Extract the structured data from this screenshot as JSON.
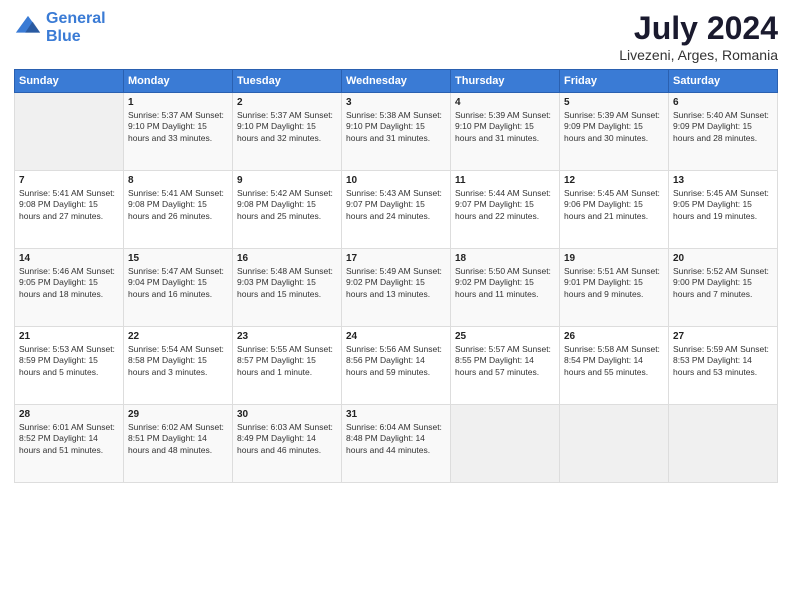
{
  "header": {
    "logo_line1": "General",
    "logo_line2": "Blue",
    "title": "July 2024",
    "subtitle": "Livezeni, Arges, Romania"
  },
  "days_of_week": [
    "Sunday",
    "Monday",
    "Tuesday",
    "Wednesday",
    "Thursday",
    "Friday",
    "Saturday"
  ],
  "weeks": [
    [
      {
        "day": "",
        "info": ""
      },
      {
        "day": "1",
        "info": "Sunrise: 5:37 AM\nSunset: 9:10 PM\nDaylight: 15 hours\nand 33 minutes."
      },
      {
        "day": "2",
        "info": "Sunrise: 5:37 AM\nSunset: 9:10 PM\nDaylight: 15 hours\nand 32 minutes."
      },
      {
        "day": "3",
        "info": "Sunrise: 5:38 AM\nSunset: 9:10 PM\nDaylight: 15 hours\nand 31 minutes."
      },
      {
        "day": "4",
        "info": "Sunrise: 5:39 AM\nSunset: 9:10 PM\nDaylight: 15 hours\nand 31 minutes."
      },
      {
        "day": "5",
        "info": "Sunrise: 5:39 AM\nSunset: 9:09 PM\nDaylight: 15 hours\nand 30 minutes."
      },
      {
        "day": "6",
        "info": "Sunrise: 5:40 AM\nSunset: 9:09 PM\nDaylight: 15 hours\nand 28 minutes."
      }
    ],
    [
      {
        "day": "7",
        "info": "Sunrise: 5:41 AM\nSunset: 9:08 PM\nDaylight: 15 hours\nand 27 minutes."
      },
      {
        "day": "8",
        "info": "Sunrise: 5:41 AM\nSunset: 9:08 PM\nDaylight: 15 hours\nand 26 minutes."
      },
      {
        "day": "9",
        "info": "Sunrise: 5:42 AM\nSunset: 9:08 PM\nDaylight: 15 hours\nand 25 minutes."
      },
      {
        "day": "10",
        "info": "Sunrise: 5:43 AM\nSunset: 9:07 PM\nDaylight: 15 hours\nand 24 minutes."
      },
      {
        "day": "11",
        "info": "Sunrise: 5:44 AM\nSunset: 9:07 PM\nDaylight: 15 hours\nand 22 minutes."
      },
      {
        "day": "12",
        "info": "Sunrise: 5:45 AM\nSunset: 9:06 PM\nDaylight: 15 hours\nand 21 minutes."
      },
      {
        "day": "13",
        "info": "Sunrise: 5:45 AM\nSunset: 9:05 PM\nDaylight: 15 hours\nand 19 minutes."
      }
    ],
    [
      {
        "day": "14",
        "info": "Sunrise: 5:46 AM\nSunset: 9:05 PM\nDaylight: 15 hours\nand 18 minutes."
      },
      {
        "day": "15",
        "info": "Sunrise: 5:47 AM\nSunset: 9:04 PM\nDaylight: 15 hours\nand 16 minutes."
      },
      {
        "day": "16",
        "info": "Sunrise: 5:48 AM\nSunset: 9:03 PM\nDaylight: 15 hours\nand 15 minutes."
      },
      {
        "day": "17",
        "info": "Sunrise: 5:49 AM\nSunset: 9:02 PM\nDaylight: 15 hours\nand 13 minutes."
      },
      {
        "day": "18",
        "info": "Sunrise: 5:50 AM\nSunset: 9:02 PM\nDaylight: 15 hours\nand 11 minutes."
      },
      {
        "day": "19",
        "info": "Sunrise: 5:51 AM\nSunset: 9:01 PM\nDaylight: 15 hours\nand 9 minutes."
      },
      {
        "day": "20",
        "info": "Sunrise: 5:52 AM\nSunset: 9:00 PM\nDaylight: 15 hours\nand 7 minutes."
      }
    ],
    [
      {
        "day": "21",
        "info": "Sunrise: 5:53 AM\nSunset: 8:59 PM\nDaylight: 15 hours\nand 5 minutes."
      },
      {
        "day": "22",
        "info": "Sunrise: 5:54 AM\nSunset: 8:58 PM\nDaylight: 15 hours\nand 3 minutes."
      },
      {
        "day": "23",
        "info": "Sunrise: 5:55 AM\nSunset: 8:57 PM\nDaylight: 15 hours\nand 1 minute."
      },
      {
        "day": "24",
        "info": "Sunrise: 5:56 AM\nSunset: 8:56 PM\nDaylight: 14 hours\nand 59 minutes."
      },
      {
        "day": "25",
        "info": "Sunrise: 5:57 AM\nSunset: 8:55 PM\nDaylight: 14 hours\nand 57 minutes."
      },
      {
        "day": "26",
        "info": "Sunrise: 5:58 AM\nSunset: 8:54 PM\nDaylight: 14 hours\nand 55 minutes."
      },
      {
        "day": "27",
        "info": "Sunrise: 5:59 AM\nSunset: 8:53 PM\nDaylight: 14 hours\nand 53 minutes."
      }
    ],
    [
      {
        "day": "28",
        "info": "Sunrise: 6:01 AM\nSunset: 8:52 PM\nDaylight: 14 hours\nand 51 minutes."
      },
      {
        "day": "29",
        "info": "Sunrise: 6:02 AM\nSunset: 8:51 PM\nDaylight: 14 hours\nand 48 minutes."
      },
      {
        "day": "30",
        "info": "Sunrise: 6:03 AM\nSunset: 8:49 PM\nDaylight: 14 hours\nand 46 minutes."
      },
      {
        "day": "31",
        "info": "Sunrise: 6:04 AM\nSunset: 8:48 PM\nDaylight: 14 hours\nand 44 minutes."
      },
      {
        "day": "",
        "info": ""
      },
      {
        "day": "",
        "info": ""
      },
      {
        "day": "",
        "info": ""
      }
    ]
  ]
}
